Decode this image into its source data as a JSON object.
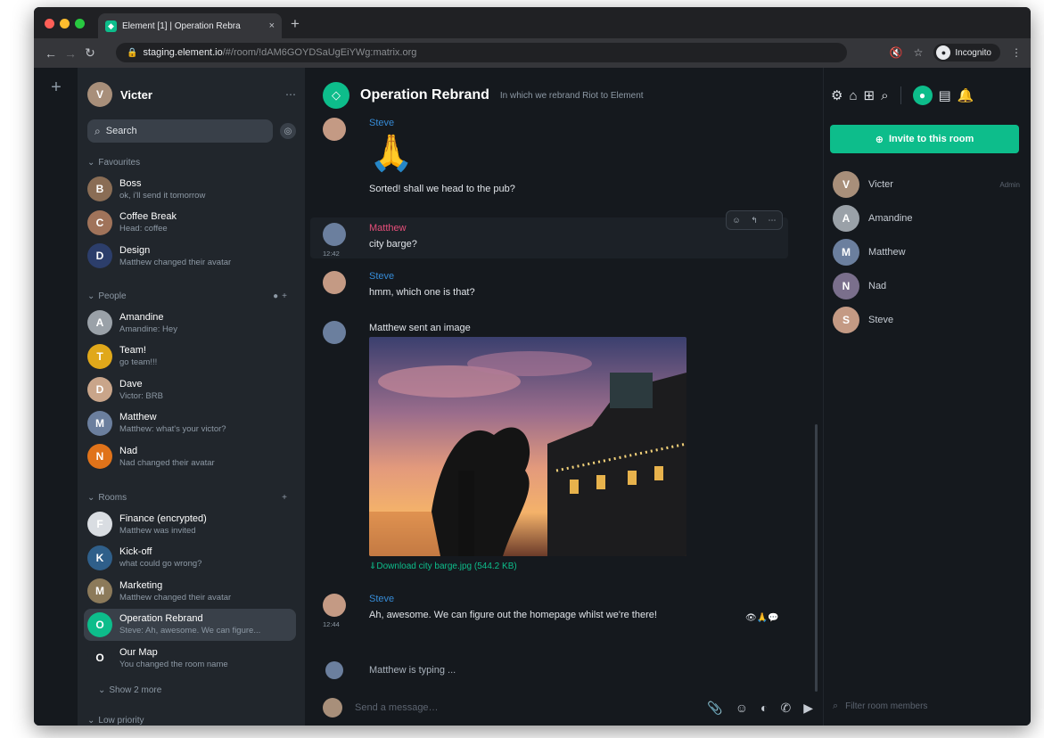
{
  "browser": {
    "tab_title": "Element [1] | Operation Rebra",
    "tab_close": "×",
    "new_tab": "+",
    "url_host": "staging.element.io",
    "url_path": "/#/room/!dAM6GOYDSaUgEiYWg:matrix.org",
    "incognito_label": "Incognito"
  },
  "user": {
    "name": "Victer"
  },
  "search": {
    "label": "Search"
  },
  "sections": {
    "favourites": "Favourites",
    "people": "People",
    "rooms": "Rooms",
    "low_priority": "Low priority"
  },
  "favourites": [
    {
      "name": "Boss",
      "message": "ok, i'll send it tomorrow",
      "color": "#8a6d55"
    },
    {
      "name": "Coffee Break",
      "message": "Head: coffee",
      "color": "#a0735a"
    },
    {
      "name": "Design",
      "message": "Matthew changed their avatar",
      "color": "#2c3e6b"
    }
  ],
  "people": [
    {
      "name": "Amandine",
      "message": "Amandine: Hey",
      "color": "#9aa1a8"
    },
    {
      "name": "Team!",
      "message": "go team!!!",
      "color": "#e0a81a"
    },
    {
      "name": "Dave",
      "message": "Victor: BRB",
      "color": "#c9a58a"
    },
    {
      "name": "Matthew",
      "message": "Matthew: what's your victor?",
      "color": "#6b7f9e"
    },
    {
      "name": "Nad",
      "message": "Nad changed their avatar",
      "color": "#e0731a"
    }
  ],
  "rooms": [
    {
      "name": "Finance (encrypted)",
      "message": "Matthew was invited",
      "color": "#d9dde2"
    },
    {
      "name": "Kick-off",
      "message": "what could go wrong?",
      "color": "#2f5f8a"
    },
    {
      "name": "Marketing",
      "message": "Matthew changed their avatar",
      "color": "#8c7a5a"
    },
    {
      "name": "Operation Rebrand",
      "message": "Steve: Ah, awesome. We can figure...",
      "color": "#0dbd8b"
    },
    {
      "name": "Our Map",
      "message": "You changed the room name",
      "color": "#21262c"
    }
  ],
  "show_more": "Show 2 more",
  "room": {
    "name": "Operation Rebrand",
    "topic": "In which we rebrand Riot to Element"
  },
  "messages": [
    {
      "sender": "Steve",
      "sender_color": "#368bd6",
      "emoji": "🙏",
      "text": "Sorted! shall we head to the pub?"
    },
    {
      "sender": "Matthew",
      "sender_color": "#e64f7a",
      "time": "12:42",
      "text": "city barge?"
    },
    {
      "sender": "Steve",
      "sender_color": "#368bd6",
      "text": "hmm, which one is that?"
    },
    {
      "text": "Matthew sent an image",
      "download": "⇓Download city barge.jpg (544.2 KB)"
    },
    {
      "sender": "Steve",
      "sender_color": "#368bd6",
      "time": "12:44",
      "text": "Ah, awesome. We can figure out the homepage whilst we're there!",
      "reactions": "👁🙏💬"
    }
  ],
  "typing": "Matthew is typing ...",
  "composer": {
    "placeholder": "Send a message…"
  },
  "invite_label": "Invite to this room",
  "members": [
    {
      "name": "Victer",
      "role": "Admin",
      "color": "#a88f7a"
    },
    {
      "name": "Amandine",
      "role": "",
      "color": "#9aa1a8"
    },
    {
      "name": "Matthew",
      "role": "",
      "color": "#6b7f9e"
    },
    {
      "name": "Nad",
      "role": "",
      "color": "#7a6f8c"
    },
    {
      "name": "Steve",
      "role": "",
      "color": "#c49a84"
    }
  ],
  "filter_placeholder": "Filter room members",
  "colors": {
    "accent": "#0dbd8b",
    "bg": "#15191e",
    "sidebar": "#21262c"
  }
}
